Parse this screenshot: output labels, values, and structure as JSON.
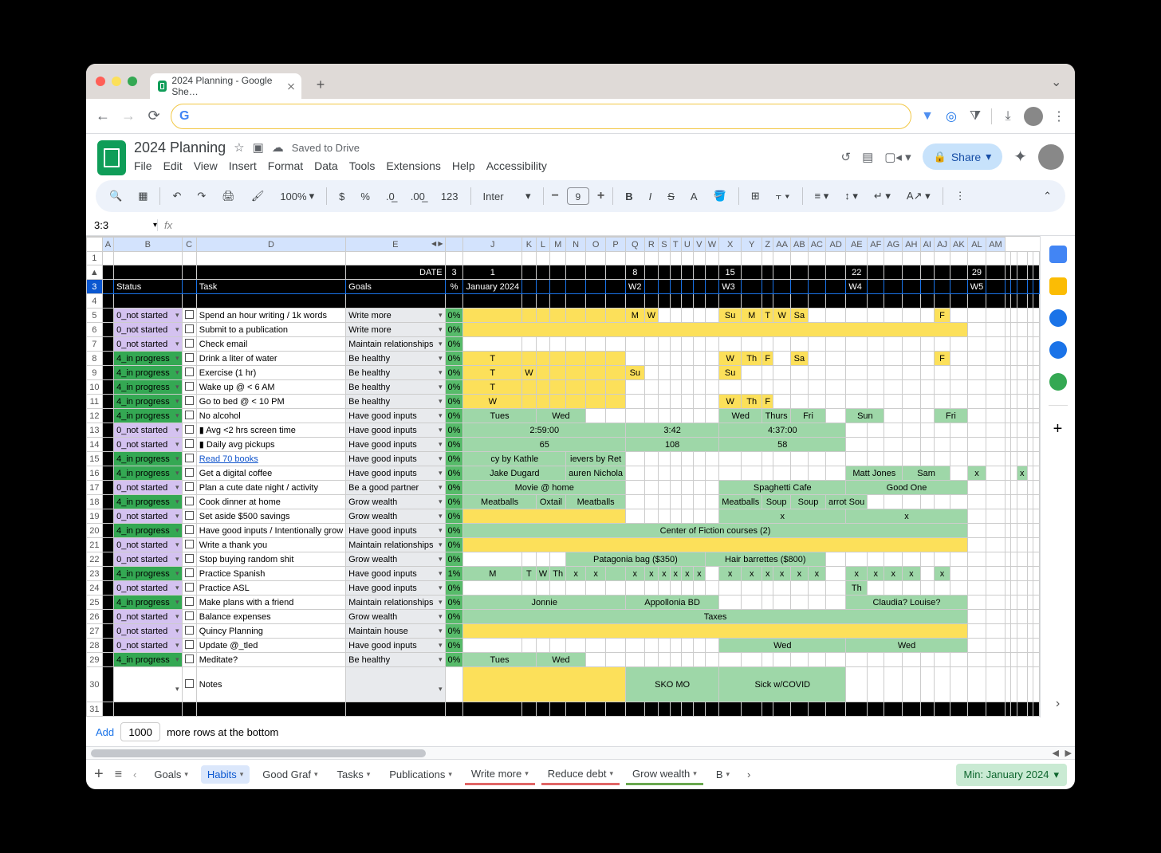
{
  "browser": {
    "tab_title": "2024 Planning - Google She…",
    "omnibox": ""
  },
  "doc": {
    "title": "2024 Planning",
    "saved": "Saved to Drive",
    "menus": [
      "File",
      "Edit",
      "View",
      "Insert",
      "Format",
      "Data",
      "Tools",
      "Extensions",
      "Help",
      "Accessibility"
    ],
    "share": "Share"
  },
  "toolbar": {
    "zoom": "100%",
    "font": "Inter",
    "size": "9",
    "numfmt": "123"
  },
  "formula": {
    "namebox": "3:3",
    "fx": ""
  },
  "sheet": {
    "col_letters": [
      "A",
      "B",
      "C",
      "D",
      "E",
      "",
      "",
      "J",
      "K",
      "L",
      "M",
      "N",
      "O",
      "P",
      "Q",
      "R",
      "S",
      "T",
      "U",
      "V",
      "W",
      "X",
      "Y",
      "Z",
      "AA",
      "AB",
      "AC",
      "AD",
      "AE",
      "AF",
      "AG",
      "AH",
      "AI",
      "AJ",
      "AK",
      "AL",
      "AM"
    ],
    "date_row": {
      "label": "DATE",
      "cells": [
        "3",
        "1",
        "",
        "",
        "",
        "",
        "",
        "",
        "8",
        "",
        "",
        "",
        "",
        "",
        "",
        "15",
        "",
        "",
        "",
        "",
        "",
        "",
        "22",
        "",
        "",
        "",
        "",
        "",
        "",
        "29",
        "",
        "",
        "",
        "",
        ""
      ]
    },
    "header_row": {
      "B": "Status",
      "D": "Task",
      "E": "Goals",
      "pct": "%",
      "month": "January 2024",
      "weeks": [
        "W2",
        "W3",
        "W4",
        "W5"
      ]
    },
    "rows": [
      {
        "n": 5,
        "status": "0_not started",
        "cls": "purple",
        "task": "Spend an hour writing / 1k words",
        "goal": "Write more",
        "pct": "0%",
        "cells": {
          "8": "M",
          "9": "W",
          "15": "Su",
          "16": "M",
          "17": "T",
          "18": "W",
          "19": "Sa",
          "27": "F"
        },
        "fill": "yellow"
      },
      {
        "n": 6,
        "status": "0_not started",
        "cls": "purple",
        "task": "Submit to a publication",
        "goal": "Write more",
        "pct": "0%",
        "span": {
          "from": 1,
          "to": 28,
          "cls": "yellow"
        }
      },
      {
        "n": 7,
        "status": "0_not started",
        "cls": "purple",
        "task": "Check email",
        "goal": "Maintain relationships",
        "pct": "0%"
      },
      {
        "n": 8,
        "status": "4_in progress",
        "cls": "green",
        "task": "Drink a liter of water",
        "goal": "Be healthy",
        "pct": "0%",
        "cells": {
          "1": "T",
          "15": "W",
          "16": "Th",
          "17": "F",
          "19": "Sa",
          "27": "F"
        },
        "fill": "yellow"
      },
      {
        "n": 9,
        "status": "4_in progress",
        "cls": "green",
        "task": "Exercise (1 hr)",
        "goal": "Be healthy",
        "pct": "0%",
        "cells": {
          "1": "T",
          "2": "W",
          "8": "Su",
          "15": "Su"
        },
        "fill": "yellow"
      },
      {
        "n": 10,
        "status": "4_in progress",
        "cls": "green",
        "task": "Wake up @ < 6 AM",
        "goal": "Be healthy",
        "pct": "0%",
        "cells": {
          "1": "T"
        },
        "fill": "yellow"
      },
      {
        "n": 11,
        "status": "4_in progress",
        "cls": "green",
        "task": "Go to bed @ < 10 PM",
        "goal": "Be healthy",
        "pct": "0%",
        "cells": {
          "1": "W",
          "15": "W",
          "16": "Th",
          "17": "F"
        },
        "fill": "yellow"
      },
      {
        "n": 12,
        "status": "4_in progress",
        "cls": "green",
        "task": "No alcohol",
        "goal": "Have good inputs",
        "pct": "0%",
        "spans": [
          {
            "from": 1,
            "to": 2,
            "text": "Tues",
            "cls": "lgreen"
          },
          {
            "from": 3,
            "to": 5,
            "text": "Wed",
            "cls": "lgreen"
          },
          {
            "from": 15,
            "to": 16,
            "text": "Wed",
            "cls": "lgreen"
          },
          {
            "from": 17,
            "to": 18,
            "text": "Thurs",
            "cls": "lgreen"
          },
          {
            "from": 19,
            "to": 20,
            "text": "Fri",
            "cls": "lgreen"
          },
          {
            "from": 22,
            "to": 23,
            "text": "Sun",
            "cls": "lgreen"
          },
          {
            "from": 27,
            "to": 28,
            "text": "Fri",
            "cls": "lgreen"
          }
        ]
      },
      {
        "n": 13,
        "status": "0_not started",
        "cls": "purple",
        "task": "▮ Avg <2 hrs screen time",
        "goal": "Have good inputs",
        "pct": "0%",
        "spans": [
          {
            "from": 1,
            "to": 7,
            "text": "2:59:00",
            "cls": "lgreen"
          },
          {
            "from": 8,
            "to": 14,
            "text": "3:42",
            "cls": "lgreen"
          },
          {
            "from": 15,
            "to": 21,
            "text": "4:37:00",
            "cls": "lgreen"
          }
        ]
      },
      {
        "n": 14,
        "status": "0_not started",
        "cls": "purple",
        "task": "▮ Daily avg pickups",
        "goal": "Have good inputs",
        "pct": "0%",
        "spans": [
          {
            "from": 1,
            "to": 7,
            "text": "65",
            "cls": "lgreen"
          },
          {
            "from": 8,
            "to": 14,
            "text": "108",
            "cls": "lgreen"
          },
          {
            "from": 15,
            "to": 21,
            "text": "58",
            "cls": "lgreen"
          }
        ]
      },
      {
        "n": 15,
        "status": "4_in progress",
        "cls": "green",
        "task": "Read 70 books",
        "tasklink": true,
        "goal": "Have good inputs",
        "pct": "0%",
        "spans": [
          {
            "from": 1,
            "to": 4,
            "text": "cy by Kathle",
            "cls": "lgreen"
          },
          {
            "from": 5,
            "to": 7,
            "text": "ievers by Ret",
            "cls": "lgreen"
          }
        ]
      },
      {
        "n": 16,
        "status": "4_in progress",
        "cls": "green",
        "task": "Get a digital coffee",
        "goal": "Have good inputs",
        "pct": "0%",
        "spans": [
          {
            "from": 1,
            "to": 4,
            "text": "Jake Dugard",
            "cls": "lgreen"
          },
          {
            "from": 5,
            "to": 7,
            "text": "auren Nichola",
            "cls": "lgreen"
          },
          {
            "from": 22,
            "to": 24,
            "text": "Matt Jones",
            "cls": "lgreen"
          },
          {
            "from": 25,
            "to": 27,
            "text": "Sam",
            "cls": "lgreen"
          },
          {
            "from": 29,
            "to": 29,
            "text": "x",
            "cls": "lgreen"
          },
          {
            "from": 33,
            "to": 33,
            "text": "x",
            "cls": "lgreen"
          }
        ]
      },
      {
        "n": 17,
        "status": "0_not started",
        "cls": "purple",
        "task": "Plan a cute date night / activity",
        "goal": "Be a good partner",
        "pct": "0%",
        "spans": [
          {
            "from": 1,
            "to": 7,
            "text": "Movie @ home",
            "cls": "lgreen"
          },
          {
            "from": 15,
            "to": 21,
            "text": "Spaghetti Cafe",
            "cls": "lgreen"
          },
          {
            "from": 22,
            "to": 28,
            "text": "Good One",
            "cls": "lgreen"
          }
        ]
      },
      {
        "n": 18,
        "status": "4_in progress",
        "cls": "green",
        "task": "Cook dinner at home",
        "goal": "Grow wealth",
        "pct": "0%",
        "spans": [
          {
            "from": 1,
            "to": 2,
            "text": "Meatballs",
            "cls": "lgreen"
          },
          {
            "from": 3,
            "to": 4,
            "text": "Oxtail",
            "cls": "lgreen"
          },
          {
            "from": 5,
            "to": 7,
            "text": "Meatballs",
            "cls": "lgreen"
          },
          {
            "from": 15,
            "to": 16,
            "text": "Meatballs",
            "cls": "lgreen"
          },
          {
            "from": 17,
            "to": 18,
            "text": "Soup",
            "cls": "lgreen"
          },
          {
            "from": 19,
            "to": 20,
            "text": "Soup",
            "cls": "lgreen"
          },
          {
            "from": 21,
            "to": 22,
            "text": "arrot Sou",
            "cls": "lgreen"
          }
        ]
      },
      {
        "n": 19,
        "status": "0_not started",
        "cls": "purple",
        "task": "Set aside $500 savings",
        "goal": "Grow wealth",
        "pct": "0%",
        "spans": [
          {
            "from": 1,
            "to": 7,
            "text": "",
            "cls": "yellow"
          },
          {
            "from": 15,
            "to": 21,
            "text": "x",
            "cls": "lgreen"
          },
          {
            "from": 22,
            "to": 28,
            "text": "x",
            "cls": "lgreen"
          }
        ]
      },
      {
        "n": 20,
        "status": "4_in progress",
        "cls": "green",
        "task": "Have good inputs / Intentionally grow",
        "goal": "Have good inputs",
        "pct": "0%",
        "spans": [
          {
            "from": 1,
            "to": 28,
            "text": "Center of Fiction courses (2)",
            "cls": "lgreen"
          }
        ]
      },
      {
        "n": 21,
        "status": "0_not started",
        "cls": "purple",
        "task": "Write a thank you",
        "goal": "Maintain relationships",
        "pct": "0%",
        "spans": [
          {
            "from": 1,
            "to": 28,
            "text": "",
            "cls": "yellow"
          }
        ]
      },
      {
        "n": 22,
        "status": "0_not started",
        "cls": "purple",
        "task": "Stop buying random shit",
        "goal": "Grow wealth",
        "pct": "0%",
        "spans": [
          {
            "from": 5,
            "to": 13,
            "text": "Patagonia bag ($350)",
            "cls": "lgreen"
          },
          {
            "from": 14,
            "to": 20,
            "text": "Hair barrettes ($800)",
            "cls": "lgreen"
          }
        ]
      },
      {
        "n": 23,
        "status": "4_in progress",
        "cls": "green",
        "task": "Practice Spanish",
        "goal": "Have good inputs",
        "pct": "1%",
        "cells": {
          "1": "M",
          "2": "T",
          "3": "W",
          "4": "Th",
          "5": "x",
          "6": "x",
          "8": "x",
          "9": "x",
          "10": "x",
          "11": "x",
          "12": "x",
          "13": "x",
          "15": "x",
          "16": "x",
          "17": "x",
          "18": "x",
          "19": "x",
          "20": "x",
          "22": "x",
          "23": "x",
          "24": "x",
          "25": "x",
          "27": "x"
        },
        "fill": "lgreen"
      },
      {
        "n": 24,
        "status": "0_not started",
        "cls": "purple",
        "task": "Practice ASL",
        "goal": "Have good inputs",
        "pct": "0%",
        "spans": [
          {
            "from": 22,
            "to": 22,
            "text": "Th",
            "cls": "lgreen"
          }
        ]
      },
      {
        "n": 25,
        "status": "4_in progress",
        "cls": "green",
        "task": "Make plans with a friend",
        "goal": "Maintain relationships",
        "pct": "0%",
        "spans": [
          {
            "from": 1,
            "to": 7,
            "text": "Jonnie",
            "cls": "lgreen"
          },
          {
            "from": 8,
            "to": 14,
            "text": "Appollonia BD",
            "cls": "lgreen"
          },
          {
            "from": 22,
            "to": 28,
            "text": "Claudia? Louise?",
            "cls": "lgreen"
          }
        ]
      },
      {
        "n": 26,
        "status": "0_not started",
        "cls": "purple",
        "task": "Balance expenses",
        "goal": "Grow wealth",
        "pct": "0%",
        "spans": [
          {
            "from": 1,
            "to": 28,
            "text": "Taxes",
            "cls": "lgreen"
          }
        ]
      },
      {
        "n": 27,
        "status": "0_not started",
        "cls": "purple",
        "task": "Quincy Planning",
        "goal": "Maintain house",
        "pct": "0%",
        "spans": [
          {
            "from": 1,
            "to": 28,
            "text": "",
            "cls": "yellow"
          }
        ]
      },
      {
        "n": 28,
        "status": "0_not started",
        "cls": "purple",
        "task": "Update @_tled",
        "goal": "Have good inputs",
        "pct": "0%",
        "spans": [
          {
            "from": 15,
            "to": 21,
            "text": "Wed",
            "cls": "lgreen"
          },
          {
            "from": 22,
            "to": 28,
            "text": "Wed",
            "cls": "lgreen"
          }
        ]
      },
      {
        "n": 29,
        "status": "4_in progress",
        "cls": "green",
        "task": "Meditate?",
        "goal": "Be healthy",
        "pct": "0%",
        "spans": [
          {
            "from": 1,
            "to": 2,
            "text": "Tues",
            "cls": "lgreen"
          },
          {
            "from": 3,
            "to": 5,
            "text": "Wed",
            "cls": "lgreen"
          }
        ]
      },
      {
        "n": 30,
        "status": "",
        "cls": "",
        "task": "Notes",
        "goal": "",
        "pct": "",
        "spans": [
          {
            "from": 1,
            "to": 7,
            "text": "",
            "cls": "yellow"
          },
          {
            "from": 8,
            "to": 14,
            "text": "SKO MO",
            "cls": "lgreen"
          },
          {
            "from": 15,
            "to": 21,
            "text": "Sick w/COVID",
            "cls": "lgreen"
          }
        ],
        "tall": true
      }
    ]
  },
  "addrows": {
    "btn": "Add",
    "count": "1000",
    "text": "more rows at the bottom"
  },
  "tabs": [
    "Goals",
    "Habits",
    "Good Graf",
    "Tasks",
    "Publications",
    "Write more",
    "Reduce debt",
    "Grow wealth",
    "B"
  ],
  "active_tab": 1,
  "tab_colors": [
    "",
    "",
    "",
    "",
    "",
    "#e06666",
    "#e06666",
    "#6aa84f",
    ""
  ],
  "summary": "Min: January 2024"
}
